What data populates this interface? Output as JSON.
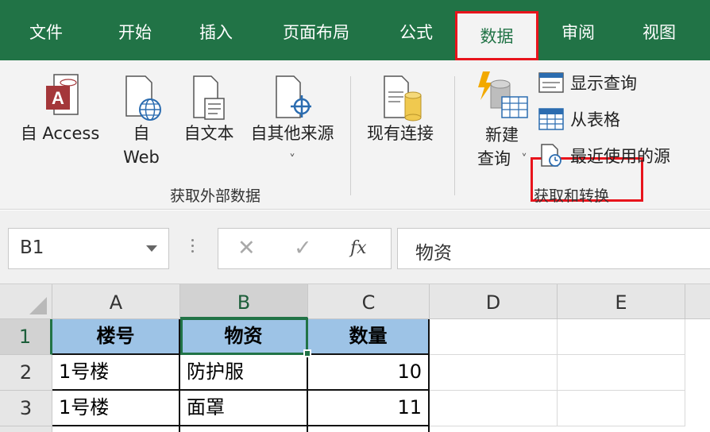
{
  "menu": {
    "tabs": [
      {
        "label": "文件"
      },
      {
        "label": "开始"
      },
      {
        "label": "插入"
      },
      {
        "label": "页面布局"
      },
      {
        "label": "公式"
      },
      {
        "label": "数据"
      },
      {
        "label": "审阅"
      },
      {
        "label": "视图"
      }
    ],
    "active_tab": "数据"
  },
  "ribbon": {
    "get_external_data": {
      "group_label": "获取外部数据",
      "access_label": "自 Access",
      "web_label_1": "自",
      "web_label_2": "Web",
      "text_label": "自文本",
      "other_label": "自其他来源",
      "other_dropdown": "˅",
      "existing_label": "现有连接"
    },
    "get_transform": {
      "group_label": "获取和转换",
      "new_query_label_1": "新建",
      "new_query_label_2": "查询",
      "new_query_dropdown": "˅",
      "show_queries": "显示查询",
      "from_table": "从表格",
      "recent_sources": "最近使用的源"
    },
    "icons": {
      "access": "access-db-icon",
      "web": "web-globe-icon",
      "text": "text-file-icon",
      "other": "other-sources-icon",
      "existing": "existing-connections-icon",
      "new_query": "new-query-icon",
      "show_queries": "show-queries-icon",
      "from_table": "table-icon",
      "recent": "recent-sources-icon"
    }
  },
  "formula_bar": {
    "name_box": "B1",
    "cancel_symbol": "✕",
    "enter_symbol": "✓",
    "fx": "fx",
    "formula": "物资"
  },
  "grid": {
    "columns": [
      "A",
      "B",
      "C",
      "D",
      "E"
    ],
    "rows": [
      "1",
      "2",
      "3"
    ],
    "selected_cell": "B1",
    "cells": [
      [
        "楼号",
        "物资",
        "数量"
      ],
      [
        "1号楼",
        "防护服",
        "10"
      ],
      [
        "1号楼",
        "面罩",
        "11"
      ]
    ]
  },
  "colors": {
    "excel_green": "#217346",
    "highlight_red": "#e8141c",
    "header_fill_blue": "#9dc3e6",
    "ribbon_bg": "#f3f3f3"
  }
}
